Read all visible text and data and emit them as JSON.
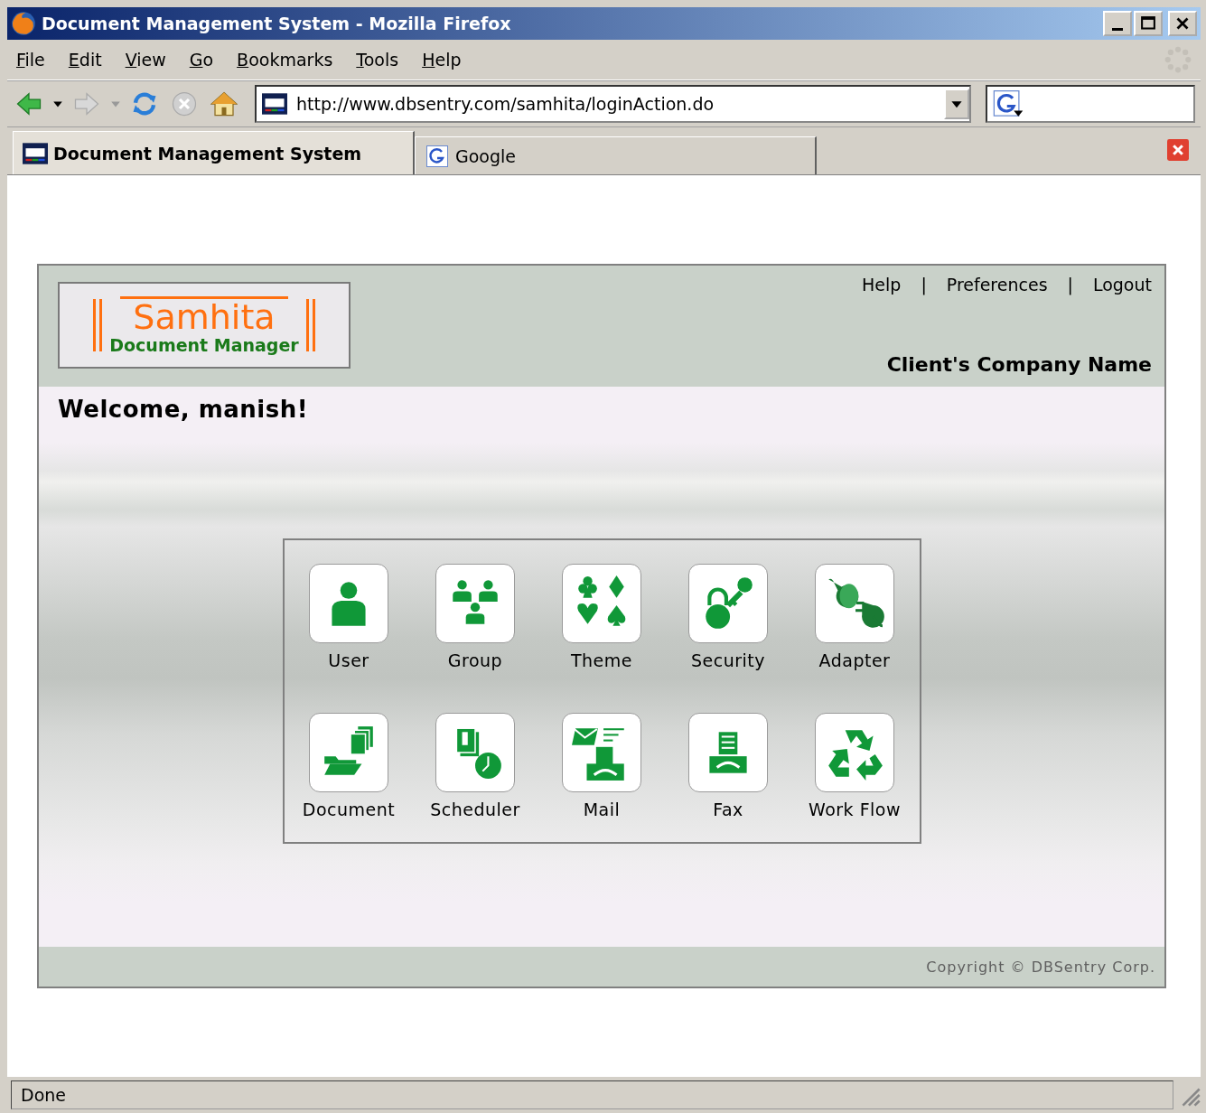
{
  "window": {
    "title": "Document Management System - Mozilla Firefox"
  },
  "menu": [
    {
      "label": "File",
      "mnemonic_underlined": true
    },
    {
      "label": "Edit",
      "mnemonic_underlined": true
    },
    {
      "label": "View",
      "mnemonic_underlined": true
    },
    {
      "label": "Go",
      "mnemonic_underlined": true
    },
    {
      "label": "Bookmarks",
      "mnemonic_underlined": true
    },
    {
      "label": "Tools",
      "mnemonic_underlined": true
    },
    {
      "label": "Help",
      "mnemonic_underlined": true
    }
  ],
  "navigation_buttons": [
    {
      "kind": "back",
      "disabled": false
    },
    {
      "kind": "forward",
      "disabled": true
    },
    {
      "kind": "reload",
      "disabled": false
    },
    {
      "kind": "stop",
      "disabled": true
    },
    {
      "kind": "home",
      "disabled": false
    }
  ],
  "address_bar": {
    "value": "http://www.dbsentry.com/samhita/loginAction.do"
  },
  "tabs": [
    {
      "label": "Document Management System",
      "selected": true,
      "kind": "site"
    },
    {
      "label": "Google",
      "selected": false,
      "kind": "search"
    }
  ],
  "page": {
    "header_links": [
      "Help",
      "Preferences",
      "Logout"
    ],
    "link_separator": "|",
    "logo": {
      "name": "Samhita",
      "subtitle": "Document Manager"
    },
    "company_name": "Client's Company Name",
    "welcome": "Welcome, manish!",
    "modules": [
      {
        "label": "User",
        "kind": "user"
      },
      {
        "label": "Group",
        "kind": "group"
      },
      {
        "label": "Theme",
        "kind": "theme"
      },
      {
        "label": "Security",
        "kind": "security"
      },
      {
        "label": "Adapter",
        "kind": "adapter"
      },
      {
        "label": "Document",
        "kind": "document"
      },
      {
        "label": "Scheduler",
        "kind": "scheduler"
      },
      {
        "label": "Mail",
        "kind": "mail"
      },
      {
        "label": "Fax",
        "kind": "fax"
      },
      {
        "label": "Work Flow",
        "kind": "workflow"
      }
    ],
    "copyright": "Copyright © DBSentry Corp."
  },
  "status_bar": {
    "text": "Done"
  }
}
